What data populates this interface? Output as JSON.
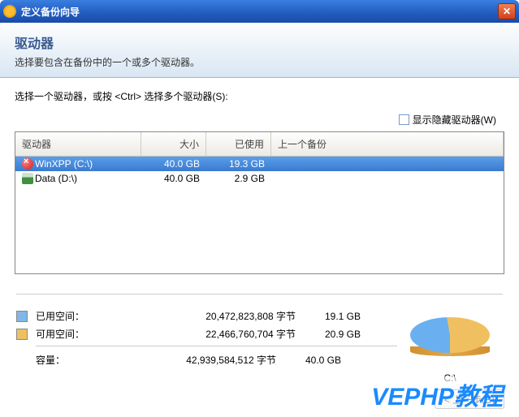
{
  "window": {
    "title": "定义备份向导"
  },
  "header": {
    "title": "驱动器",
    "subtitle": "选择要包含在备份中的一个或多个驱动器。"
  },
  "instruction": "选择一个驱动器，或按 <Ctrl> 选择多个驱动器(S):",
  "hidden_drives_label": "显示隐藏驱动器(W)",
  "table": {
    "columns": {
      "drive": "驱动器",
      "size": "大小",
      "used": "已使用",
      "last": "上一个备份"
    },
    "rows": [
      {
        "name": "WinXPP (C:\\)",
        "size": "40.0 GB",
        "used": "19.3 GB",
        "last": "",
        "icon": "win",
        "selected": true
      },
      {
        "name": "Data (D:\\)",
        "size": "40.0 GB",
        "used": "2.9 GB",
        "last": "",
        "icon": "disk",
        "selected": false
      }
    ]
  },
  "stats": {
    "used_label": "已用空间：",
    "used_bytes": "20,472,823,808 字节",
    "used_gb": "19.1 GB",
    "free_label": "可用空间：",
    "free_bytes": "22,466,760,704 字节",
    "free_gb": "20.9 GB",
    "total_label": "容量：",
    "total_bytes": "42,939,584,512 字节",
    "total_gb": "40.0 GB",
    "drive": "C:\\"
  },
  "buttons": {
    "back": "< 上一步(B)"
  },
  "watermark": "VEPHP教程",
  "colors": {
    "used": "#7fb8e8",
    "free": "#f0c060"
  }
}
